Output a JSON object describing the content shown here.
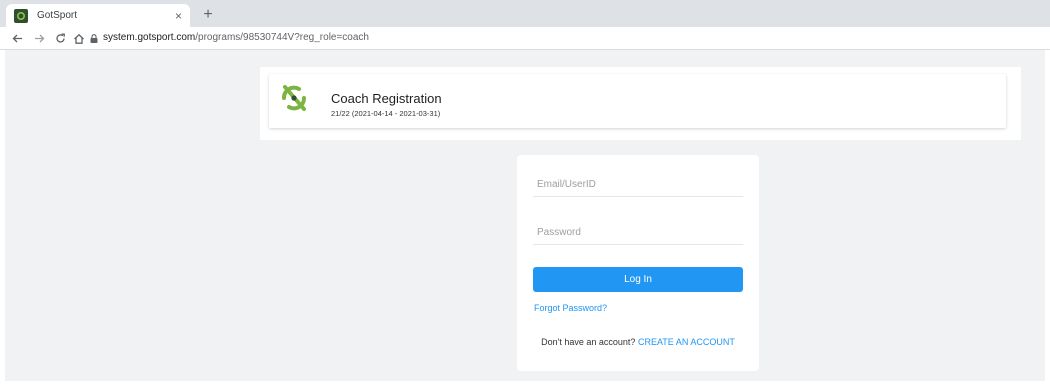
{
  "browser": {
    "tab_title": "GotSport",
    "tab_close": "×",
    "new_tab": "+",
    "url_host": "system.gotsport.com",
    "url_path": "/programs/98530744V?reg_role=coach"
  },
  "program": {
    "title": "Coach Registration",
    "dates": "21/22 (2021-04-14 - 2021-03-31)"
  },
  "login": {
    "email_placeholder": "Email/UserID",
    "password_placeholder": "Password",
    "login_label": "Log In",
    "forgot_label": "Forgot Password?",
    "signup_prompt": "Don't have an account?",
    "signup_link": "CREATE AN ACCOUNT"
  },
  "colors": {
    "brand_green": "#7cb342",
    "accent_blue": "#2196f3",
    "page_bg": "#f1f2f4"
  },
  "icons": {
    "back": "back-arrow-icon",
    "forward": "forward-arrow-icon",
    "reload": "reload-icon",
    "home": "home-icon",
    "lock": "lock-icon",
    "logo": "gotsport-logo-icon"
  }
}
